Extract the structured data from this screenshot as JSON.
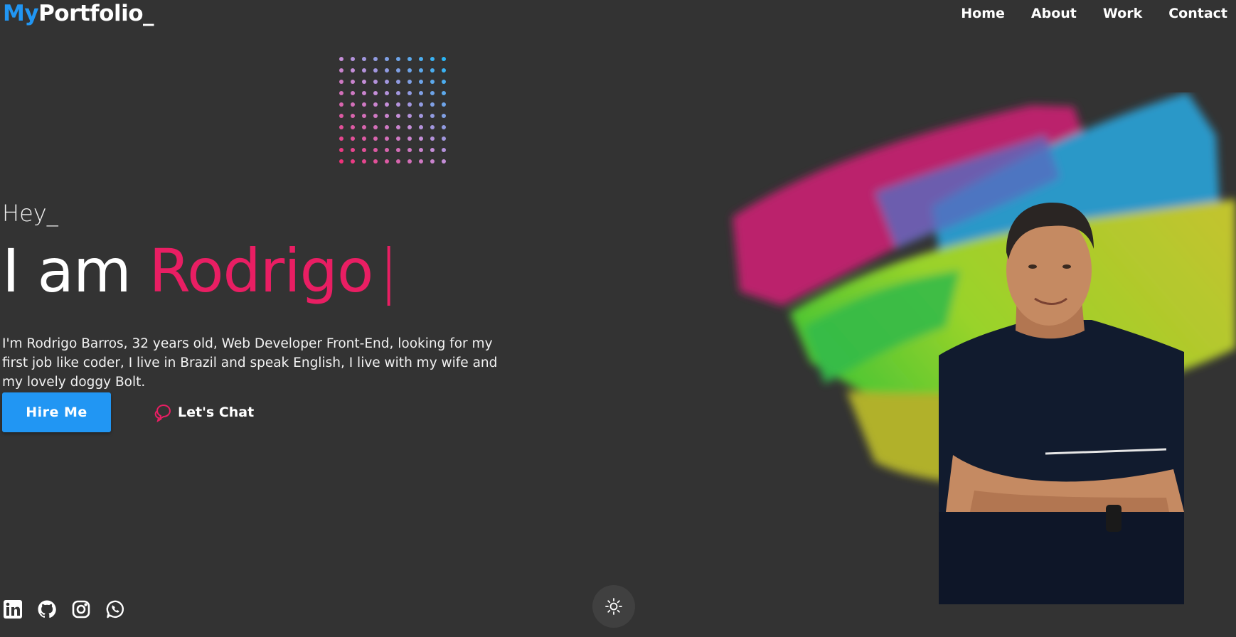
{
  "header": {
    "logo_accent": "My",
    "logo_rest": "Portfolio_",
    "nav": [
      "Home",
      "About",
      "Work",
      "Contact"
    ]
  },
  "hero": {
    "greeting": "Hey_",
    "headline_prefix": "I am",
    "name": "Rodrigo",
    "cursor": "|",
    "bio": "I'm Rodrigo Barros, 32 years old, Web Developer Front-End, looking for my first job like coder, I live in Brazil and speak English, I live with my wife and my lovely doggy Bolt.",
    "hire_button": "Hire Me",
    "chat_link": "Let's Chat"
  },
  "social_icons": [
    "linkedin-icon",
    "github-icon",
    "instagram-icon",
    "whatsapp-icon"
  ],
  "theme_toggle_icon": "sun-icon",
  "colors": {
    "background": "#333333",
    "accent_blue": "#2196f3",
    "accent_pink": "#e91e63",
    "text": "#ffffff"
  }
}
